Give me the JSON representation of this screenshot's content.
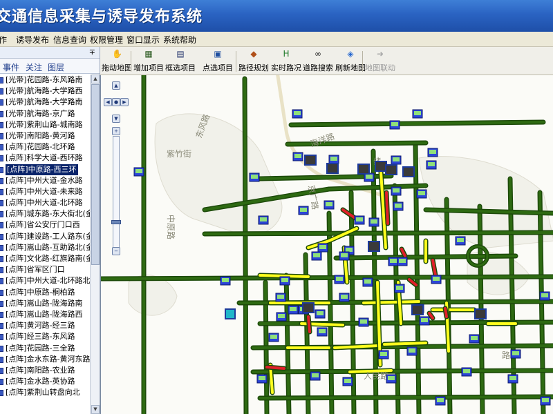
{
  "title": "交通信息采集与诱导发布系统",
  "menu": [
    "作",
    "诱导发布",
    "信息查询",
    "权限管理",
    "窗口显示",
    "系统帮助"
  ],
  "panel": {
    "pin": "∓",
    "tabs": [
      "事件",
      "关注",
      "图层"
    ],
    "items": [
      "[光带]花园路-东风路南",
      "[光带]航海路-大学路西",
      "[光带]航海路-大学路南",
      "[光带]航海路-京广路",
      "[光带]紫荆山路-城南路",
      "[光带]南阳路-黄河路",
      "[点阵]花园路-北环路",
      "[点阵]科学大道-西环路",
      "[点阵]中原路-西三环",
      "[点阵]中州大道-金水路",
      "[点阵]中州大道-未来路",
      "[点阵]中州大道-北环路",
      "[点阵]城东路-东大街北(金水",
      "[点阵]省公安厅门口西",
      "[点阵]建设路-工人路东(金水",
      "[点阵]嵩山路-互助路北(金水",
      "[点阵]文化路-红旗路南(金水",
      "[点阵]省军区门口",
      "[点阵]中州大道-北环路北(联",
      "[点阵]中原路-桐柏路",
      "[点阵]嵩山路-陇海路南",
      "[点阵]嵩山路-陇海路西",
      "[点阵]黄河路-经三路",
      "[点阵]经三路-东风路",
      "[点阵]花园路-三全路",
      "[点阵]金水东路-黄河东路",
      "[点阵]南阳路-农业路",
      "[点阵]金水路-英协路",
      "[点阵]紫荆山转盘向北"
    ],
    "selected_index": 8
  },
  "toolbar": {
    "buttons": [
      {
        "label": "拖动地图",
        "icon": "hand-icon"
      },
      {
        "label": "增加项目",
        "icon": "add-item-icon"
      },
      {
        "label": "框选项目",
        "icon": "box-select-icon"
      },
      {
        "label": "点选项目",
        "icon": "point-select-icon"
      },
      {
        "label": "路径规划",
        "icon": "route-plan-icon"
      },
      {
        "label": "实时路况",
        "icon": "realtime-traffic-icon"
      },
      {
        "label": "道路搜索",
        "icon": "binoculars-icon"
      },
      {
        "label": "刷新地图",
        "icon": "refresh-icon"
      },
      {
        "label": "地图联动",
        "icon": "map-link-icon",
        "disabled": true
      }
    ]
  },
  "map": {
    "labels": [
      "海洋路",
      "东风路",
      "紫竹街",
      "中原路",
      "京广路",
      "人民路",
      "纬",
      "路"
    ]
  },
  "colors": {
    "road_green": "#2e6a12",
    "road_green_light": "#62a83a",
    "road_yellow": "#ffff1e",
    "road_red": "#e0202a",
    "title_blue": "#2a63c2",
    "sign_blue": "#2b44d8",
    "sign_dark": "#3a3a3a"
  }
}
